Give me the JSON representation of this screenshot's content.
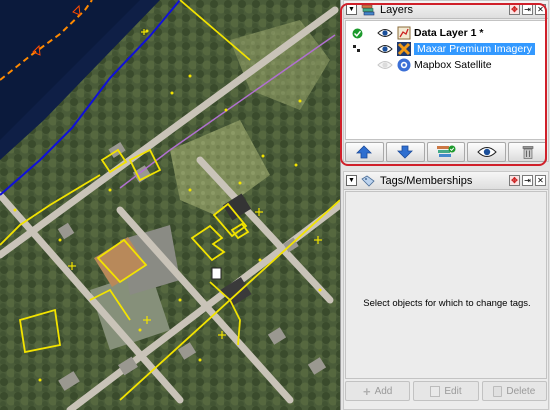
{
  "map": {
    "accent_yellow": "#f2e300",
    "road_color": "#c9c3b8",
    "boundary_color": "#1010d8",
    "track_color": "#ff8a00"
  },
  "layers_dialog": {
    "title": "Layers",
    "title_icon": "layers-stack-icon",
    "highlight_color": "#d0202a",
    "layers": [
      {
        "name": "Data Layer 1 *",
        "bold": true,
        "visible": true,
        "active": true,
        "selected": false,
        "icon": "data-layer-icon"
      },
      {
        "name": "Maxar Premium Imagery",
        "bold": false,
        "visible": true,
        "active": false,
        "selected": true,
        "icon": "imagery-layer-icon"
      },
      {
        "name": "Mapbox Satellite",
        "bold": false,
        "visible": false,
        "active": false,
        "selected": false,
        "icon": "imagery-layer-icon"
      }
    ],
    "buttons": [
      "move-up-icon",
      "move-down-icon",
      "merge-layer-icon",
      "toggle-visibility-icon",
      "delete-icon"
    ]
  },
  "tags_dialog": {
    "title": "Tags/Memberships",
    "title_icon": "tag-icon",
    "message": "Select objects for which to change tags.",
    "add_label": "Add",
    "edit_label": "Edit",
    "delete_label": "Delete"
  }
}
